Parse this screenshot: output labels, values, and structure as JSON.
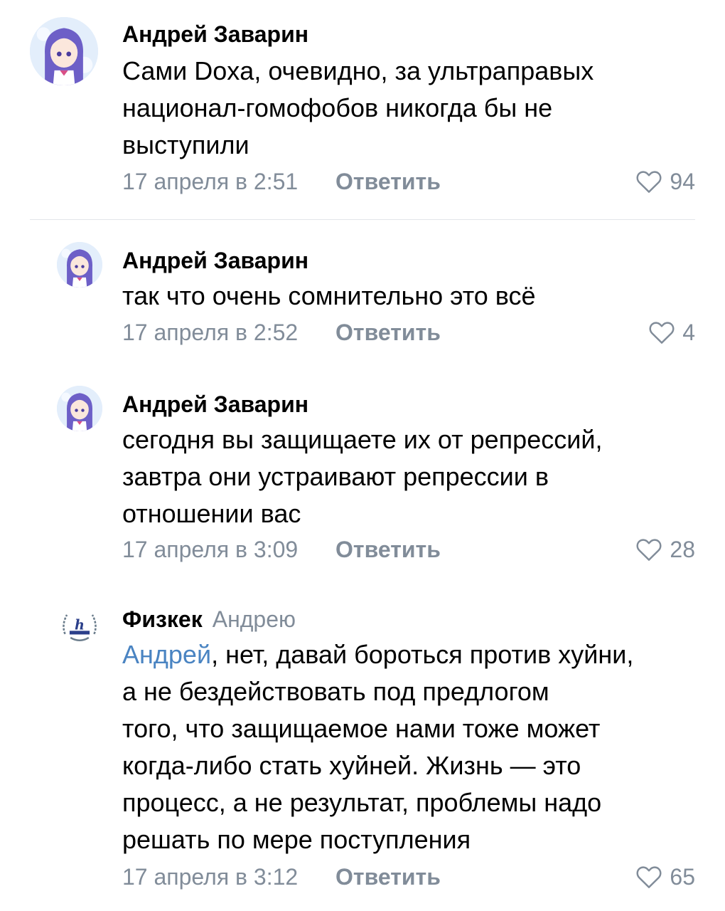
{
  "comments": [
    {
      "author": "Андрей Заварин",
      "lines": [
        "Сами Doxa, очевидно, за ультраправых",
        "национал-гомофобов никогда бы не",
        "выступили"
      ],
      "date": "17 апреля в 2:51",
      "reply_label": "Ответить",
      "likes": "94"
    },
    {
      "author": "Андрей Заварин",
      "lines": [
        "так что очень сомнительно это всё"
      ],
      "date": "17 апреля в 2:52",
      "reply_label": "Ответить",
      "likes": "4"
    },
    {
      "author": "Андрей Заварин",
      "lines": [
        "сегодня вы защищаете их от репрессий,",
        "завтра они устраивают репрессии в",
        "отношении вас"
      ],
      "date": "17 апреля в 3:09",
      "reply_label": "Ответить",
      "likes": "28"
    },
    {
      "author": "Физкек",
      "reply_to": "Андрею",
      "mention": "Андрей",
      "first_line_rest": ", нет, давай бороться против хуйни,",
      "lines": [
        "а не бездействовать под предлогом",
        "того, что защищаемое нами тоже может",
        "когда-либо стать хуйней. Жизнь — это",
        "процесс, а не результат, проблемы надо",
        "решать по мере поступления"
      ],
      "date": "17 апреля в 3:12",
      "reply_label": "Ответить",
      "likes": "65"
    }
  ],
  "icons": {
    "like": "heart-outline-icon",
    "avatar_user": "anime-girl-avatar",
    "avatar_group": "fizkek-logo"
  },
  "colors": {
    "secondary_text": "#818c99",
    "mention": "#4a84c2",
    "divider": "#e3e6ea"
  }
}
